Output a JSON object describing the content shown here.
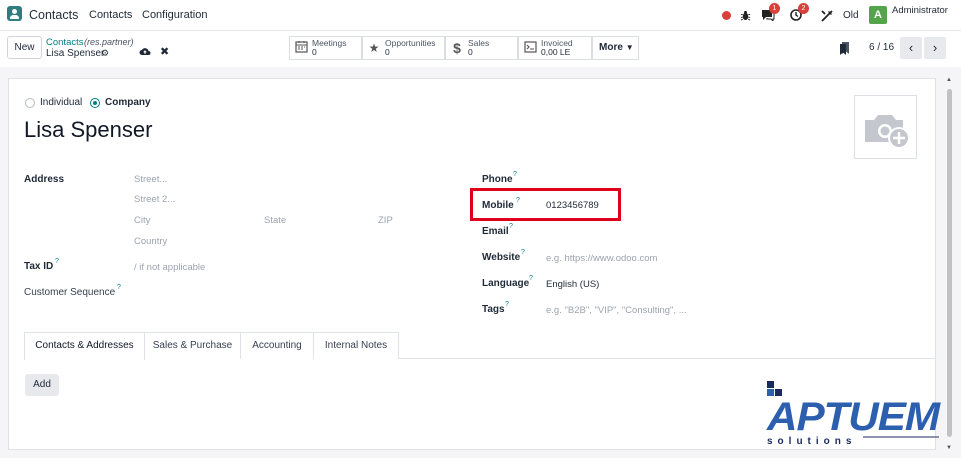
{
  "navbar": {
    "brand": "Contacts",
    "menu": [
      "Contacts",
      "Configuration"
    ],
    "status_dot_color": "#d9403a",
    "activity_badge": "1",
    "clock_badge": "2",
    "tools_label": "Old",
    "avatar_letter": "A",
    "user_name": "Administrator"
  },
  "control": {
    "new_label": "New",
    "breadcrumb_link": "Contacts",
    "breadcrumb_model": "(res.partner)",
    "record_label": "Lisa Spenser",
    "smart_buttons": [
      {
        "label": "Meetings",
        "value": "0",
        "icon": "calendar-icon"
      },
      {
        "label": "Opportunities",
        "value": "0",
        "icon": "star-icon"
      },
      {
        "label": "Sales",
        "value": "0",
        "icon": "dollar-icon"
      },
      {
        "label": "Invoiced",
        "value": "0,00 LE",
        "icon": "invoice-icon"
      }
    ],
    "more_label": "More",
    "pager": "6 / 16"
  },
  "form": {
    "type_individual": "Individual",
    "type_company": "Company",
    "name": "Lisa Spenser",
    "address_label": "Address",
    "street_ph": "Street...",
    "street2_ph": "Street 2...",
    "city_ph": "City",
    "state_ph": "State",
    "zip_ph": "ZIP",
    "country_ph": "Country",
    "taxid_label": "Tax ID",
    "taxid_ph": "/ if not applicable",
    "custseq_label": "Customer Sequence",
    "phone_label": "Phone",
    "mobile_label": "Mobile",
    "mobile_value": "0123456789",
    "email_label": "Email",
    "website_label": "Website",
    "website_ph": "e.g. https://www.odoo.com",
    "language_label": "Language",
    "language_value": "English (US)",
    "tags_label": "Tags",
    "tags_ph": "e.g. \"B2B\", \"VIP\", \"Consulting\", ...",
    "help_mark": "?"
  },
  "tabs": [
    "Contacts & Addresses",
    "Sales & Purchase",
    "Accounting",
    "Internal Notes"
  ],
  "add_label": "Add",
  "logo": {
    "word": "APTUEM",
    "tagline": "solutions"
  }
}
